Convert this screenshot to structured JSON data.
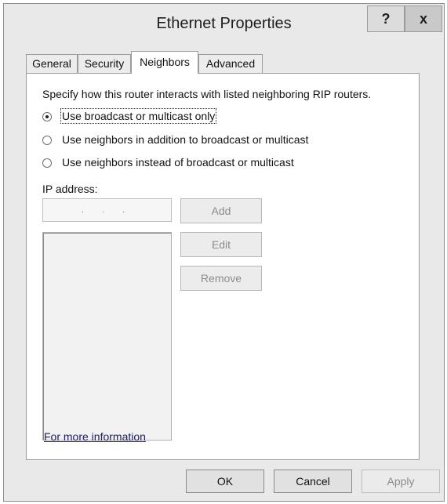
{
  "window": {
    "title": "Ethernet Properties",
    "help_glyph": "?",
    "close_glyph": "x"
  },
  "tabs": [
    {
      "label": "General",
      "active": false
    },
    {
      "label": "Security",
      "active": false
    },
    {
      "label": "Neighbors",
      "active": true
    },
    {
      "label": "Advanced",
      "active": false
    }
  ],
  "neighbors": {
    "description": "Specify how this router interacts with listed neighboring RIP routers.",
    "radio_options": [
      {
        "label": "Use broadcast or multicast only",
        "checked": true
      },
      {
        "label": "Use neighbors in addition to broadcast or multicast",
        "checked": false
      },
      {
        "label": "Use neighbors instead of broadcast or multicast",
        "checked": false
      }
    ],
    "ip_label": "IP address:",
    "ip_value": ". . .",
    "add_label": "Add",
    "edit_label": "Edit",
    "remove_label": "Remove",
    "more_info_link": "For more information"
  },
  "footer": {
    "ok_label": "OK",
    "cancel_label": "Cancel",
    "apply_label": "Apply"
  },
  "colors": {
    "window_bg": "#e9e9e9",
    "panel_bg": "#ffffff",
    "link": "#1a1a6e",
    "disabled_text": "#8c8c8c"
  }
}
